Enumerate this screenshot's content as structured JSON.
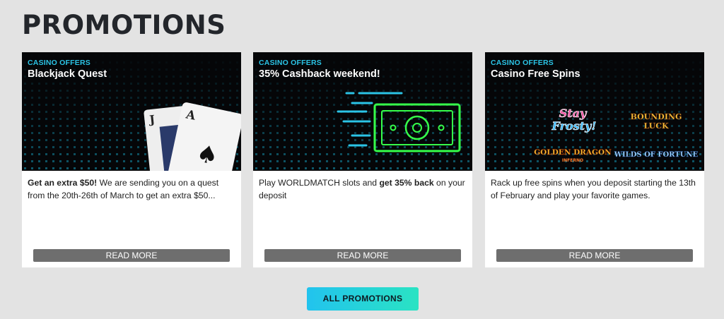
{
  "page": {
    "title": "PROMOTIONS"
  },
  "promotions": [
    {
      "category": "CASINO OFFERS",
      "title": "Blackjack Quest",
      "desc_bold": "Get an extra $50!",
      "desc_rest": " We are sending you on a quest from the 20th-26th of March to get an extra $50...",
      "button": "READ MORE",
      "cards": [
        "J",
        "A"
      ]
    },
    {
      "category": "CASINO OFFERS",
      "title": "35% Cashback weekend!",
      "desc_pre": "Play WORLDMATCH slots and ",
      "desc_bold": "get 35% back",
      "desc_post": " on your deposit",
      "button": "READ MORE"
    },
    {
      "category": "CASINO OFFERS",
      "title": "Casino Free Spins",
      "desc": "Rack up free spins when you deposit starting the 13th of February and play your favorite games.",
      "button": "READ MORE",
      "games": {
        "stay_frosty": [
          "Stay",
          "Frosty!"
        ],
        "bounding_luck": [
          "BOUNDING",
          "LUCK"
        ],
        "golden_dragon": [
          "GOLDEN DRAGON",
          "INFERNO"
        ],
        "wilds_of_fortune": "WILDS OF FORTUNE"
      }
    }
  ],
  "footer": {
    "all_button": "ALL PROMOTIONS"
  },
  "colors": {
    "background": "#e3e3e3",
    "accent": "#2bc4e6",
    "button_grey": "#6e6e6e",
    "gradient_start": "#22c3ee",
    "gradient_end": "#2ae3c3",
    "neon_green": "#36ff4a"
  }
}
